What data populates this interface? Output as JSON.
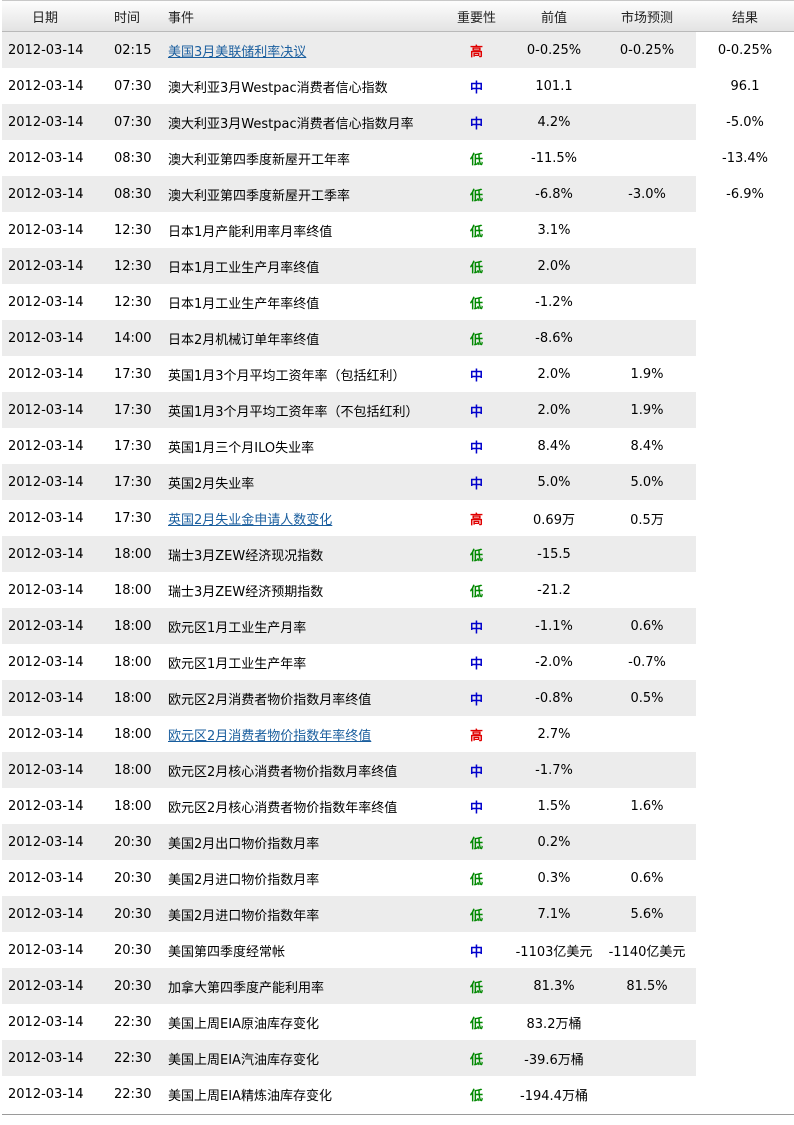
{
  "headers": {
    "date": "日期",
    "time": "时间",
    "event": "事件",
    "importance": "重要性",
    "previous": "前值",
    "forecast": "市场预测",
    "result": "结果"
  },
  "importance_colors": {
    "high": "#e00000",
    "mid": "#0000cc",
    "low": "#008800"
  },
  "rows": [
    {
      "date": "2012-03-14",
      "time": "02:15",
      "event": "美国3月美联储利率决议",
      "link": true,
      "importance": "高",
      "level": "high",
      "previous": "0-0.25%",
      "forecast": "0-0.25%",
      "result": "0-0.25%"
    },
    {
      "date": "2012-03-14",
      "time": "07:30",
      "event": "澳大利亚3月Westpac消费者信心指数",
      "link": false,
      "importance": "中",
      "level": "mid",
      "previous": "101.1",
      "forecast": "",
      "result": "96.1"
    },
    {
      "date": "2012-03-14",
      "time": "07:30",
      "event": "澳大利亚3月Westpac消费者信心指数月率",
      "link": false,
      "importance": "中",
      "level": "mid",
      "previous": "4.2%",
      "forecast": "",
      "result": "-5.0%"
    },
    {
      "date": "2012-03-14",
      "time": "08:30",
      "event": "澳大利亚第四季度新屋开工年率",
      "link": false,
      "importance": "低",
      "level": "low",
      "previous": "-11.5%",
      "forecast": "",
      "result": "-13.4%"
    },
    {
      "date": "2012-03-14",
      "time": "08:30",
      "event": "澳大利亚第四季度新屋开工季率",
      "link": false,
      "importance": "低",
      "level": "low",
      "previous": "-6.8%",
      "forecast": "-3.0%",
      "result": "-6.9%"
    },
    {
      "date": "2012-03-14",
      "time": "12:30",
      "event": "日本1月产能利用率月率终值",
      "link": false,
      "importance": "低",
      "level": "low",
      "previous": "3.1%",
      "forecast": "",
      "result": ""
    },
    {
      "date": "2012-03-14",
      "time": "12:30",
      "event": "日本1月工业生产月率终值",
      "link": false,
      "importance": "低",
      "level": "low",
      "previous": "2.0%",
      "forecast": "",
      "result": ""
    },
    {
      "date": "2012-03-14",
      "time": "12:30",
      "event": "日本1月工业生产年率终值",
      "link": false,
      "importance": "低",
      "level": "low",
      "previous": "-1.2%",
      "forecast": "",
      "result": ""
    },
    {
      "date": "2012-03-14",
      "time": "14:00",
      "event": "日本2月机械订单年率终值",
      "link": false,
      "importance": "低",
      "level": "low",
      "previous": "-8.6%",
      "forecast": "",
      "result": ""
    },
    {
      "date": "2012-03-14",
      "time": "17:30",
      "event": "英国1月3个月平均工资年率（包括红利）",
      "link": false,
      "importance": "中",
      "level": "mid",
      "previous": "2.0%",
      "forecast": "1.9%",
      "result": ""
    },
    {
      "date": "2012-03-14",
      "time": "17:30",
      "event": "英国1月3个月平均工资年率（不包括红利）",
      "link": false,
      "importance": "中",
      "level": "mid",
      "previous": "2.0%",
      "forecast": "1.9%",
      "result": ""
    },
    {
      "date": "2012-03-14",
      "time": "17:30",
      "event": "英国1月三个月ILO失业率",
      "link": false,
      "importance": "中",
      "level": "mid",
      "previous": "8.4%",
      "forecast": "8.4%",
      "result": ""
    },
    {
      "date": "2012-03-14",
      "time": "17:30",
      "event": "英国2月失业率",
      "link": false,
      "importance": "中",
      "level": "mid",
      "previous": "5.0%",
      "forecast": "5.0%",
      "result": ""
    },
    {
      "date": "2012-03-14",
      "time": "17:30",
      "event": "英国2月失业金申请人数变化",
      "link": true,
      "importance": "高",
      "level": "high",
      "previous": "0.69万",
      "forecast": "0.5万",
      "result": ""
    },
    {
      "date": "2012-03-14",
      "time": "18:00",
      "event": "瑞士3月ZEW经济现况指数",
      "link": false,
      "importance": "低",
      "level": "low",
      "previous": "-15.5",
      "forecast": "",
      "result": ""
    },
    {
      "date": "2012-03-14",
      "time": "18:00",
      "event": "瑞士3月ZEW经济预期指数",
      "link": false,
      "importance": "低",
      "level": "low",
      "previous": "-21.2",
      "forecast": "",
      "result": ""
    },
    {
      "date": "2012-03-14",
      "time": "18:00",
      "event": "欧元区1月工业生产月率",
      "link": false,
      "importance": "中",
      "level": "mid",
      "previous": "-1.1%",
      "forecast": "0.6%",
      "result": ""
    },
    {
      "date": "2012-03-14",
      "time": "18:00",
      "event": "欧元区1月工业生产年率",
      "link": false,
      "importance": "中",
      "level": "mid",
      "previous": "-2.0%",
      "forecast": "-0.7%",
      "result": ""
    },
    {
      "date": "2012-03-14",
      "time": "18:00",
      "event": "欧元区2月消费者物价指数月率终值",
      "link": false,
      "importance": "中",
      "level": "mid",
      "previous": "-0.8%",
      "forecast": "0.5%",
      "result": ""
    },
    {
      "date": "2012-03-14",
      "time": "18:00",
      "event": "欧元区2月消费者物价指数年率终值",
      "link": true,
      "importance": "高",
      "level": "high",
      "previous": "2.7%",
      "forecast": "",
      "result": ""
    },
    {
      "date": "2012-03-14",
      "time": "18:00",
      "event": "欧元区2月核心消费者物价指数月率终值",
      "link": false,
      "importance": "中",
      "level": "mid",
      "previous": "-1.7%",
      "forecast": "",
      "result": ""
    },
    {
      "date": "2012-03-14",
      "time": "18:00",
      "event": "欧元区2月核心消费者物价指数年率终值",
      "link": false,
      "importance": "中",
      "level": "mid",
      "previous": "1.5%",
      "forecast": "1.6%",
      "result": ""
    },
    {
      "date": "2012-03-14",
      "time": "20:30",
      "event": "美国2月出口物价指数月率",
      "link": false,
      "importance": "低",
      "level": "low",
      "previous": "0.2%",
      "forecast": "",
      "result": ""
    },
    {
      "date": "2012-03-14",
      "time": "20:30",
      "event": "美国2月进口物价指数月率",
      "link": false,
      "importance": "低",
      "level": "low",
      "previous": "0.3%",
      "forecast": "0.6%",
      "result": ""
    },
    {
      "date": "2012-03-14",
      "time": "20:30",
      "event": "美国2月进口物价指数年率",
      "link": false,
      "importance": "低",
      "level": "low",
      "previous": "7.1%",
      "forecast": "5.6%",
      "result": ""
    },
    {
      "date": "2012-03-14",
      "time": "20:30",
      "event": "美国第四季度经常帐",
      "link": false,
      "importance": "中",
      "level": "mid",
      "previous": "-1103亿美元",
      "forecast": "-1140亿美元",
      "result": ""
    },
    {
      "date": "2012-03-14",
      "time": "20:30",
      "event": "加拿大第四季度产能利用率",
      "link": false,
      "importance": "低",
      "level": "low",
      "previous": "81.3%",
      "forecast": "81.5%",
      "result": ""
    },
    {
      "date": "2012-03-14",
      "time": "22:30",
      "event": "美国上周EIA原油库存变化",
      "link": false,
      "importance": "低",
      "level": "low",
      "previous": "83.2万桶",
      "forecast": "",
      "result": ""
    },
    {
      "date": "2012-03-14",
      "time": "22:30",
      "event": "美国上周EIA汽油库存变化",
      "link": false,
      "importance": "低",
      "level": "low",
      "previous": "-39.6万桶",
      "forecast": "",
      "result": ""
    },
    {
      "date": "2012-03-14",
      "time": "22:30",
      "event": "美国上周EIA精炼油库存变化",
      "link": false,
      "importance": "低",
      "level": "low",
      "previous": "-194.4万桶",
      "forecast": "",
      "result": ""
    }
  ]
}
